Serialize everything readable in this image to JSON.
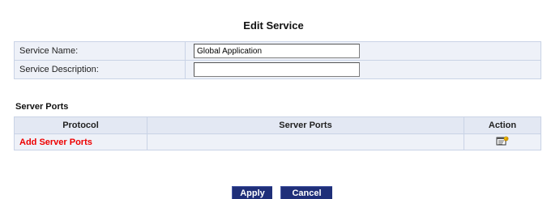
{
  "page": {
    "title": "Edit Service"
  },
  "form": {
    "service_name_label": "Service Name:",
    "service_name_value": "Global Application",
    "service_description_label": "Service Description:",
    "service_description_value": ""
  },
  "server_ports": {
    "section_title": "Server Ports",
    "columns": [
      "Protocol",
      "Server Ports",
      "Action"
    ],
    "add_link": "Add Server Ports",
    "action_icon": "edit-icon"
  },
  "buttons": {
    "apply": "Apply",
    "cancel": "Cancel"
  },
  "colors": {
    "table_border": "#c9d3e6",
    "row_bg": "#eef1f8",
    "header_bg": "#e3e8f3",
    "link_red": "#ee0000",
    "button_bg": "#1f2f79"
  }
}
